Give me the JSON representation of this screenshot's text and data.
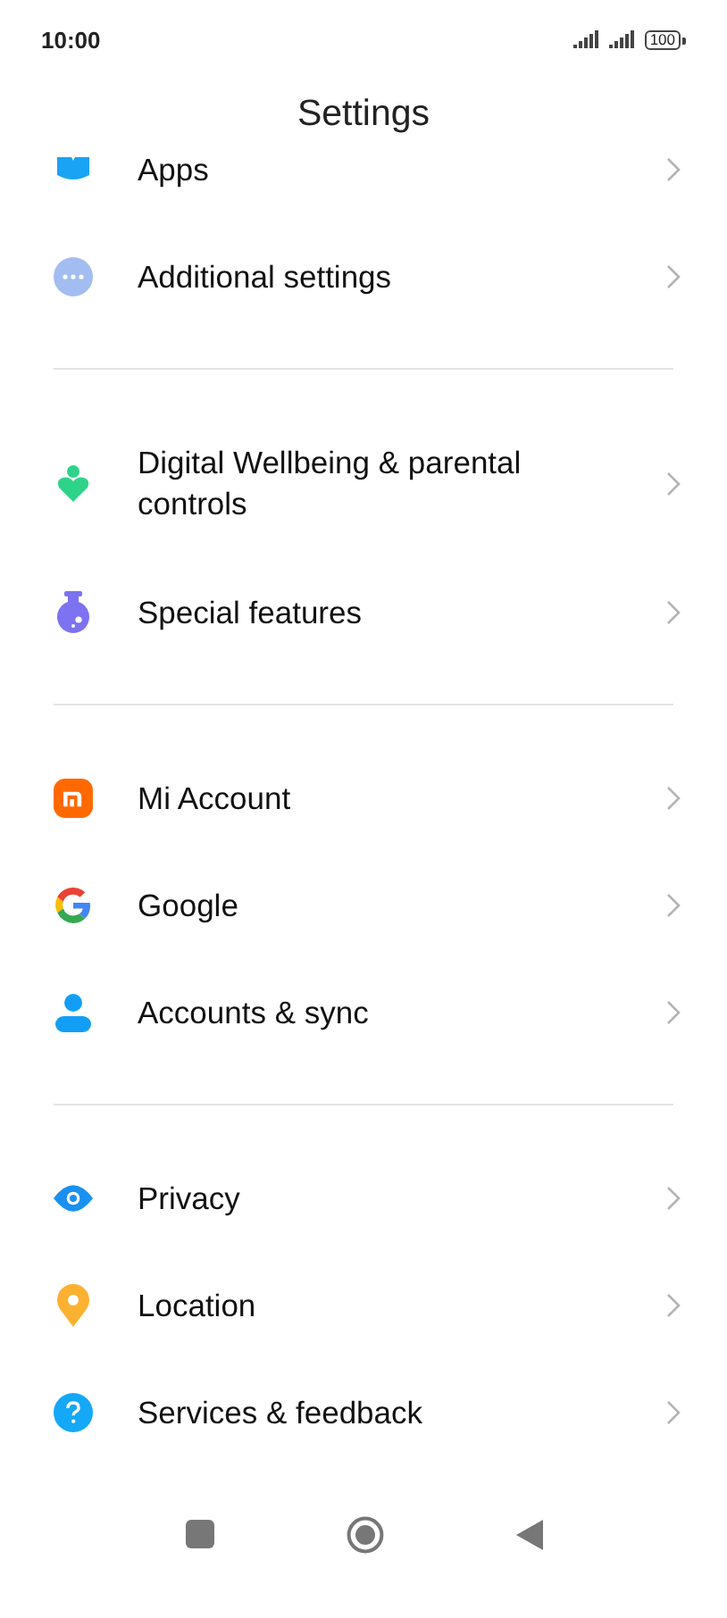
{
  "status_bar": {
    "time": "10:00",
    "battery": "100"
  },
  "title": "Settings",
  "sections": [
    {
      "items": [
        {
          "label": "Apps"
        },
        {
          "label": "Additional settings"
        }
      ]
    },
    {
      "items": [
        {
          "label": "Digital Wellbeing & parental controls"
        },
        {
          "label": "Special features"
        }
      ]
    },
    {
      "items": [
        {
          "label": "Mi Account"
        },
        {
          "label": "Google"
        },
        {
          "label": "Accounts & sync"
        }
      ]
    },
    {
      "items": [
        {
          "label": "Privacy"
        },
        {
          "label": "Location"
        },
        {
          "label": "Services & feedback"
        }
      ]
    }
  ]
}
